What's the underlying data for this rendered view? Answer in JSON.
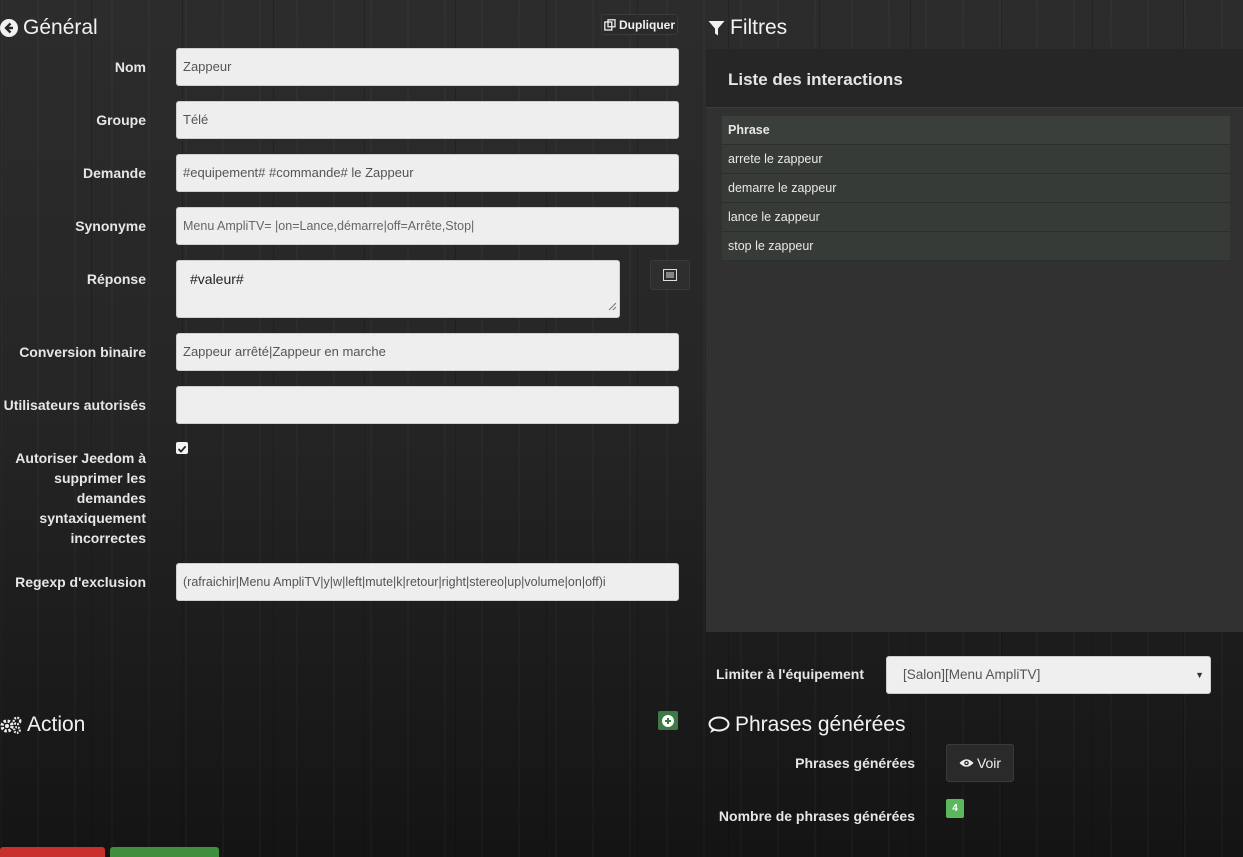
{
  "general": {
    "title": "Général",
    "duplicate_label": "Dupliquer"
  },
  "fields": {
    "nom": {
      "label": "Nom",
      "value": "Zappeur"
    },
    "groupe": {
      "label": "Groupe",
      "value": "Télé"
    },
    "demande": {
      "label": "Demande",
      "value": "#equipement# #commande# le Zappeur"
    },
    "synonyme": {
      "label": "Synonyme",
      "value": "Menu AmpliTV= |on=Lance,démarre|off=Arrête,Stop|"
    },
    "reponse": {
      "label": "Réponse",
      "value": "#valeur#"
    },
    "conversion": {
      "label": "Conversion binaire",
      "value": "Zappeur arrêté|Zappeur en marche"
    },
    "utilisateurs": {
      "label": "Utilisateurs autorisés",
      "value": ""
    },
    "autoriser": {
      "label_lines": [
        "Autoriser Jeedom à",
        "supprimer les",
        "demandes",
        "syntaxiquement",
        "incorrectes"
      ],
      "checked": true
    },
    "regexp": {
      "label": "Regexp d'exclusion",
      "value": "(rafraichir|Menu AmpliTV|y|w|left|mute|k|retour|right|stereo|up|volume|on|off)i"
    }
  },
  "action": {
    "title": "Action"
  },
  "filters": {
    "title": "Filtres"
  },
  "interactions": {
    "title": "Liste des interactions",
    "column": "Phrase",
    "rows": [
      "arrete le zappeur",
      "demarre le zappeur",
      "lance le zappeur",
      "stop le zappeur"
    ]
  },
  "limit": {
    "label": "Limiter à l'équipement",
    "selected": "[Salon][Menu AmpliTV]"
  },
  "generated": {
    "title": "Phrases générées",
    "phrases_label": "Phrases générées",
    "voir_label": "Voir",
    "count_label": "Nombre de phrases générées",
    "count": "4"
  },
  "colors": {
    "badge": "#5cb85c",
    "delete": "#c9302c",
    "save": "#3f8f3f"
  }
}
